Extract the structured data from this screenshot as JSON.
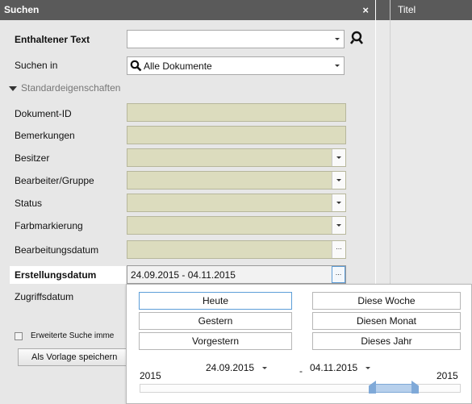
{
  "panel": {
    "title": "Suchen",
    "close": "×"
  },
  "right_header": {
    "title": "Titel"
  },
  "fields": {
    "enthaltener_text": {
      "label": "Enthaltener Text",
      "value": ""
    },
    "suchen_in": {
      "label": "Suchen in",
      "value": "Alle Dokumente"
    },
    "section": "Standardeigenschaften",
    "dokument_id": "Dokument-ID",
    "bemerkungen": "Bemerkungen",
    "besitzer": "Besitzer",
    "bearbeiter": "Bearbeiter/Gruppe",
    "status": "Status",
    "farbmarkierung": "Farbmarkierung",
    "bearbeitungsdatum": "Bearbeitungsdatum",
    "erstellungsdatum": {
      "label": "Erstellungsdatum",
      "value": "24.09.2015 - 04.11.2015"
    },
    "zugriffsdatum": "Zugriffsdatum"
  },
  "bottom": {
    "checkbox_label": "Erweiterte Suche imme",
    "template_button": "Als Vorlage speichern"
  },
  "popup": {
    "buttons": {
      "heute": "Heute",
      "gestern": "Gestern",
      "vorgestern": "Vorgestern",
      "diese_woche": "Diese Woche",
      "diesen_monat": "Diesen Monat",
      "dieses_jahr": "Dieses Jahr"
    },
    "from_date": "24.09.2015",
    "to_date": "04.11.2015",
    "dash": "-",
    "year_left": "2015",
    "year_right": "2015",
    "range_fraction": [
      0.72,
      0.85
    ]
  },
  "colors": {
    "titlebar": "#5a5a5a",
    "field_fill": "#dcdcbe",
    "selected_button_border": "#5d9ed8",
    "range_fill": "#b7d0ec"
  }
}
